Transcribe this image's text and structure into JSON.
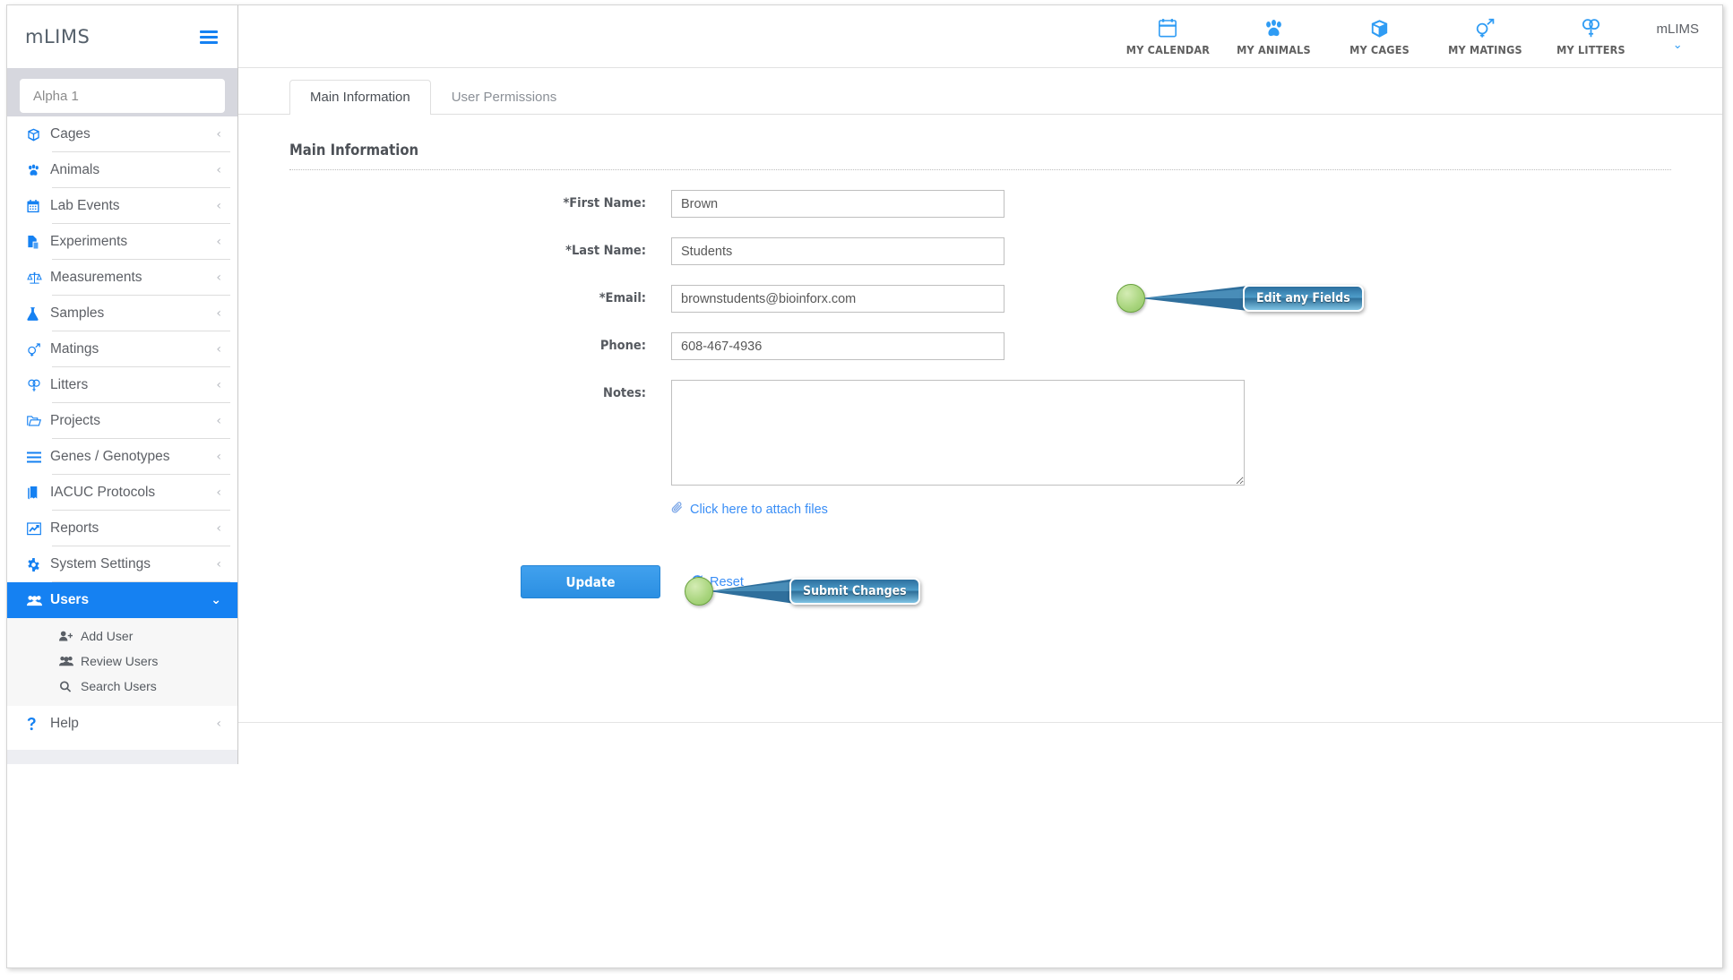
{
  "brand": {
    "name": "mLIMS",
    "menu_icon": "hamburger-icon"
  },
  "sidebar": {
    "search": {
      "placeholder": "Alpha 1",
      "value": ""
    },
    "items": [
      {
        "label": "Cages",
        "icon": "box-icon",
        "caret": "‹"
      },
      {
        "label": "Animals",
        "icon": "paw-icon",
        "caret": "‹"
      },
      {
        "label": "Lab Events",
        "icon": "calendar-icon",
        "caret": "‹"
      },
      {
        "label": "Experiments",
        "icon": "file-icon",
        "caret": "‹"
      },
      {
        "label": "Measurements",
        "icon": "scale-icon",
        "caret": "‹"
      },
      {
        "label": "Samples",
        "icon": "flask-icon",
        "caret": "‹"
      },
      {
        "label": "Matings",
        "icon": "mars-venus-icon",
        "caret": "‹"
      },
      {
        "label": "Litters",
        "icon": "venus-double-icon",
        "caret": "‹"
      },
      {
        "label": "Projects",
        "icon": "folder-icon",
        "caret": "‹"
      },
      {
        "label": "Genes / Genotypes",
        "icon": "bars-icon",
        "caret": "‹"
      },
      {
        "label": "IACUC Protocols",
        "icon": "book-icon",
        "caret": "‹"
      },
      {
        "label": "Reports",
        "icon": "chart-line-icon",
        "caret": "‹"
      },
      {
        "label": "System Settings",
        "icon": "gear-icon",
        "caret": "‹"
      }
    ],
    "active_item": {
      "label": "Users",
      "icon": "users-icon",
      "caret": "⌄"
    },
    "submenu": [
      {
        "label": "Add User",
        "icon": "user-plus-icon"
      },
      {
        "label": "Review Users",
        "icon": "users-icon"
      },
      {
        "label": "Search Users",
        "icon": "search-icon"
      }
    ],
    "help_item": {
      "label": "Help",
      "icon": "question-icon",
      "caret": "‹"
    }
  },
  "topnav": {
    "items": [
      {
        "label": "MY CALENDAR",
        "icon": "calendar-icon"
      },
      {
        "label": "MY ANIMALS",
        "icon": "paw-icon"
      },
      {
        "label": "MY CAGES",
        "icon": "box-icon"
      },
      {
        "label": "MY MATINGS",
        "icon": "mars-venus-icon"
      },
      {
        "label": "MY LITTERS",
        "icon": "venus-double-icon"
      }
    ],
    "account": {
      "label": "mLIMS",
      "caret": "⌄"
    }
  },
  "tabs": [
    {
      "label": "Main Information",
      "active": true
    },
    {
      "label": "User Permissions",
      "active": false
    }
  ],
  "main": {
    "section_title": "Main Information",
    "fields": [
      {
        "label": "*First Name:",
        "value": "Brown",
        "type": "text"
      },
      {
        "label": "*Last Name:",
        "value": "Students",
        "type": "text"
      },
      {
        "label": "*Email:",
        "value": "brownstudents@bioinforx.com",
        "type": "text"
      },
      {
        "label": "Phone:",
        "value": "608-467-4936",
        "type": "text"
      },
      {
        "label": "Notes:",
        "value": "",
        "type": "textarea"
      }
    ],
    "attach_link": {
      "label": "Click here to attach files",
      "icon": "paperclip-icon"
    },
    "update_button": "Update",
    "reset_link": {
      "label": "Reset",
      "icon": "refresh-icon"
    }
  },
  "callouts": [
    {
      "text": "Edit any Fields"
    },
    {
      "text": "Submit Changes"
    }
  ],
  "colors": {
    "accent_blue": "#1581f2",
    "topnav_icon": "#2f9cf4",
    "link_blue": "#3a8ef6",
    "callout_dot": "#a9d57e",
    "callout_bubble": "#2d6f9e"
  }
}
